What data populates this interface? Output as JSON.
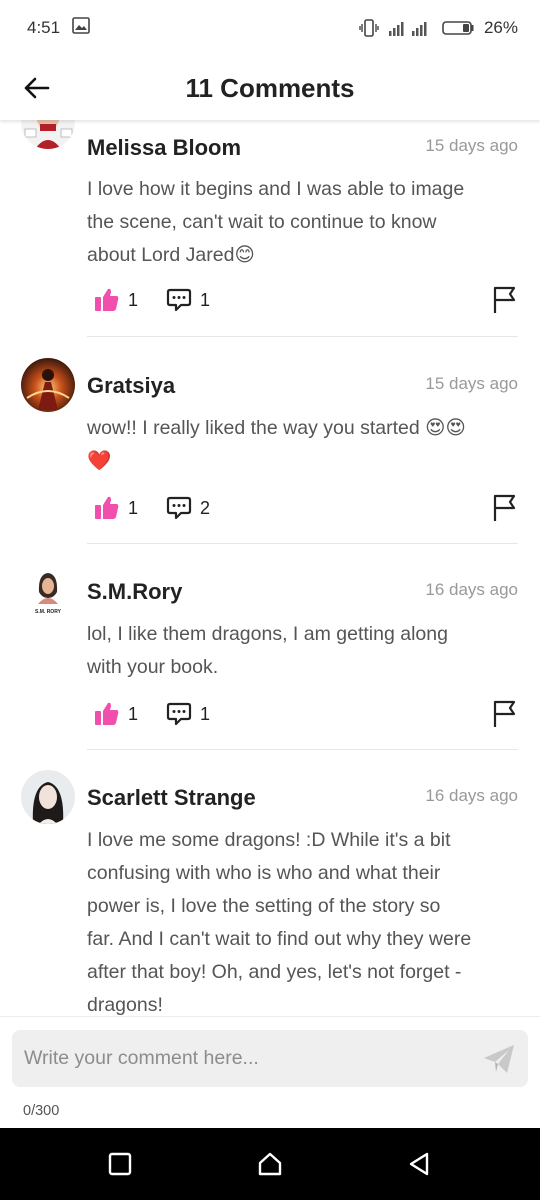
{
  "status_bar": {
    "time": "4:51",
    "battery": "26%"
  },
  "header": {
    "title": "11 Comments"
  },
  "comments": [
    {
      "author": "Melissa Bloom",
      "time": "15 days ago",
      "lines": [
        "I love how it begins and I was able to image",
        "the scene, can't wait to continue to know",
        "about Lord Jared"
      ],
      "emoji": "😊",
      "likes": "1",
      "replies": "1"
    },
    {
      "author": "Gratsiya",
      "time": "15 days ago",
      "lines": [
        "wow!! I really liked the way you started "
      ],
      "emoji": "😍😍",
      "emoji2": "❤️",
      "likes": "1",
      "replies": "2"
    },
    {
      "author": "S.M.Rory",
      "time": "16 days ago",
      "avatar_text": "S.M. RORY",
      "lines": [
        "lol, I like them dragons, I am getting along",
        "with your book."
      ],
      "likes": "1",
      "replies": "1"
    },
    {
      "author": "Scarlett Strange",
      "time": "16 days ago",
      "lines": [
        "I love me some dragons! :D While it's a bit",
        "confusing with who is who and what their",
        "power is, I love the setting of the story so",
        "far. And I can't wait to find out why they were",
        "after that boy! Oh, and yes, let's not forget  -",
        "dragons!"
      ]
    }
  ],
  "composer": {
    "placeholder": "Write your comment here...",
    "char_count": "0/300"
  },
  "colors": {
    "accent": "#f04fae",
    "muted": "#999999",
    "nav_bg": "#000000"
  },
  "icons": [
    "back-arrow-icon",
    "thumbs-up-icon",
    "reply-bubble-icon",
    "flag-icon",
    "send-icon",
    "vibrate-icon",
    "signal-icon",
    "battery-icon",
    "gallery-icon",
    "square-nav-icon",
    "home-nav-icon",
    "back-nav-icon"
  ]
}
